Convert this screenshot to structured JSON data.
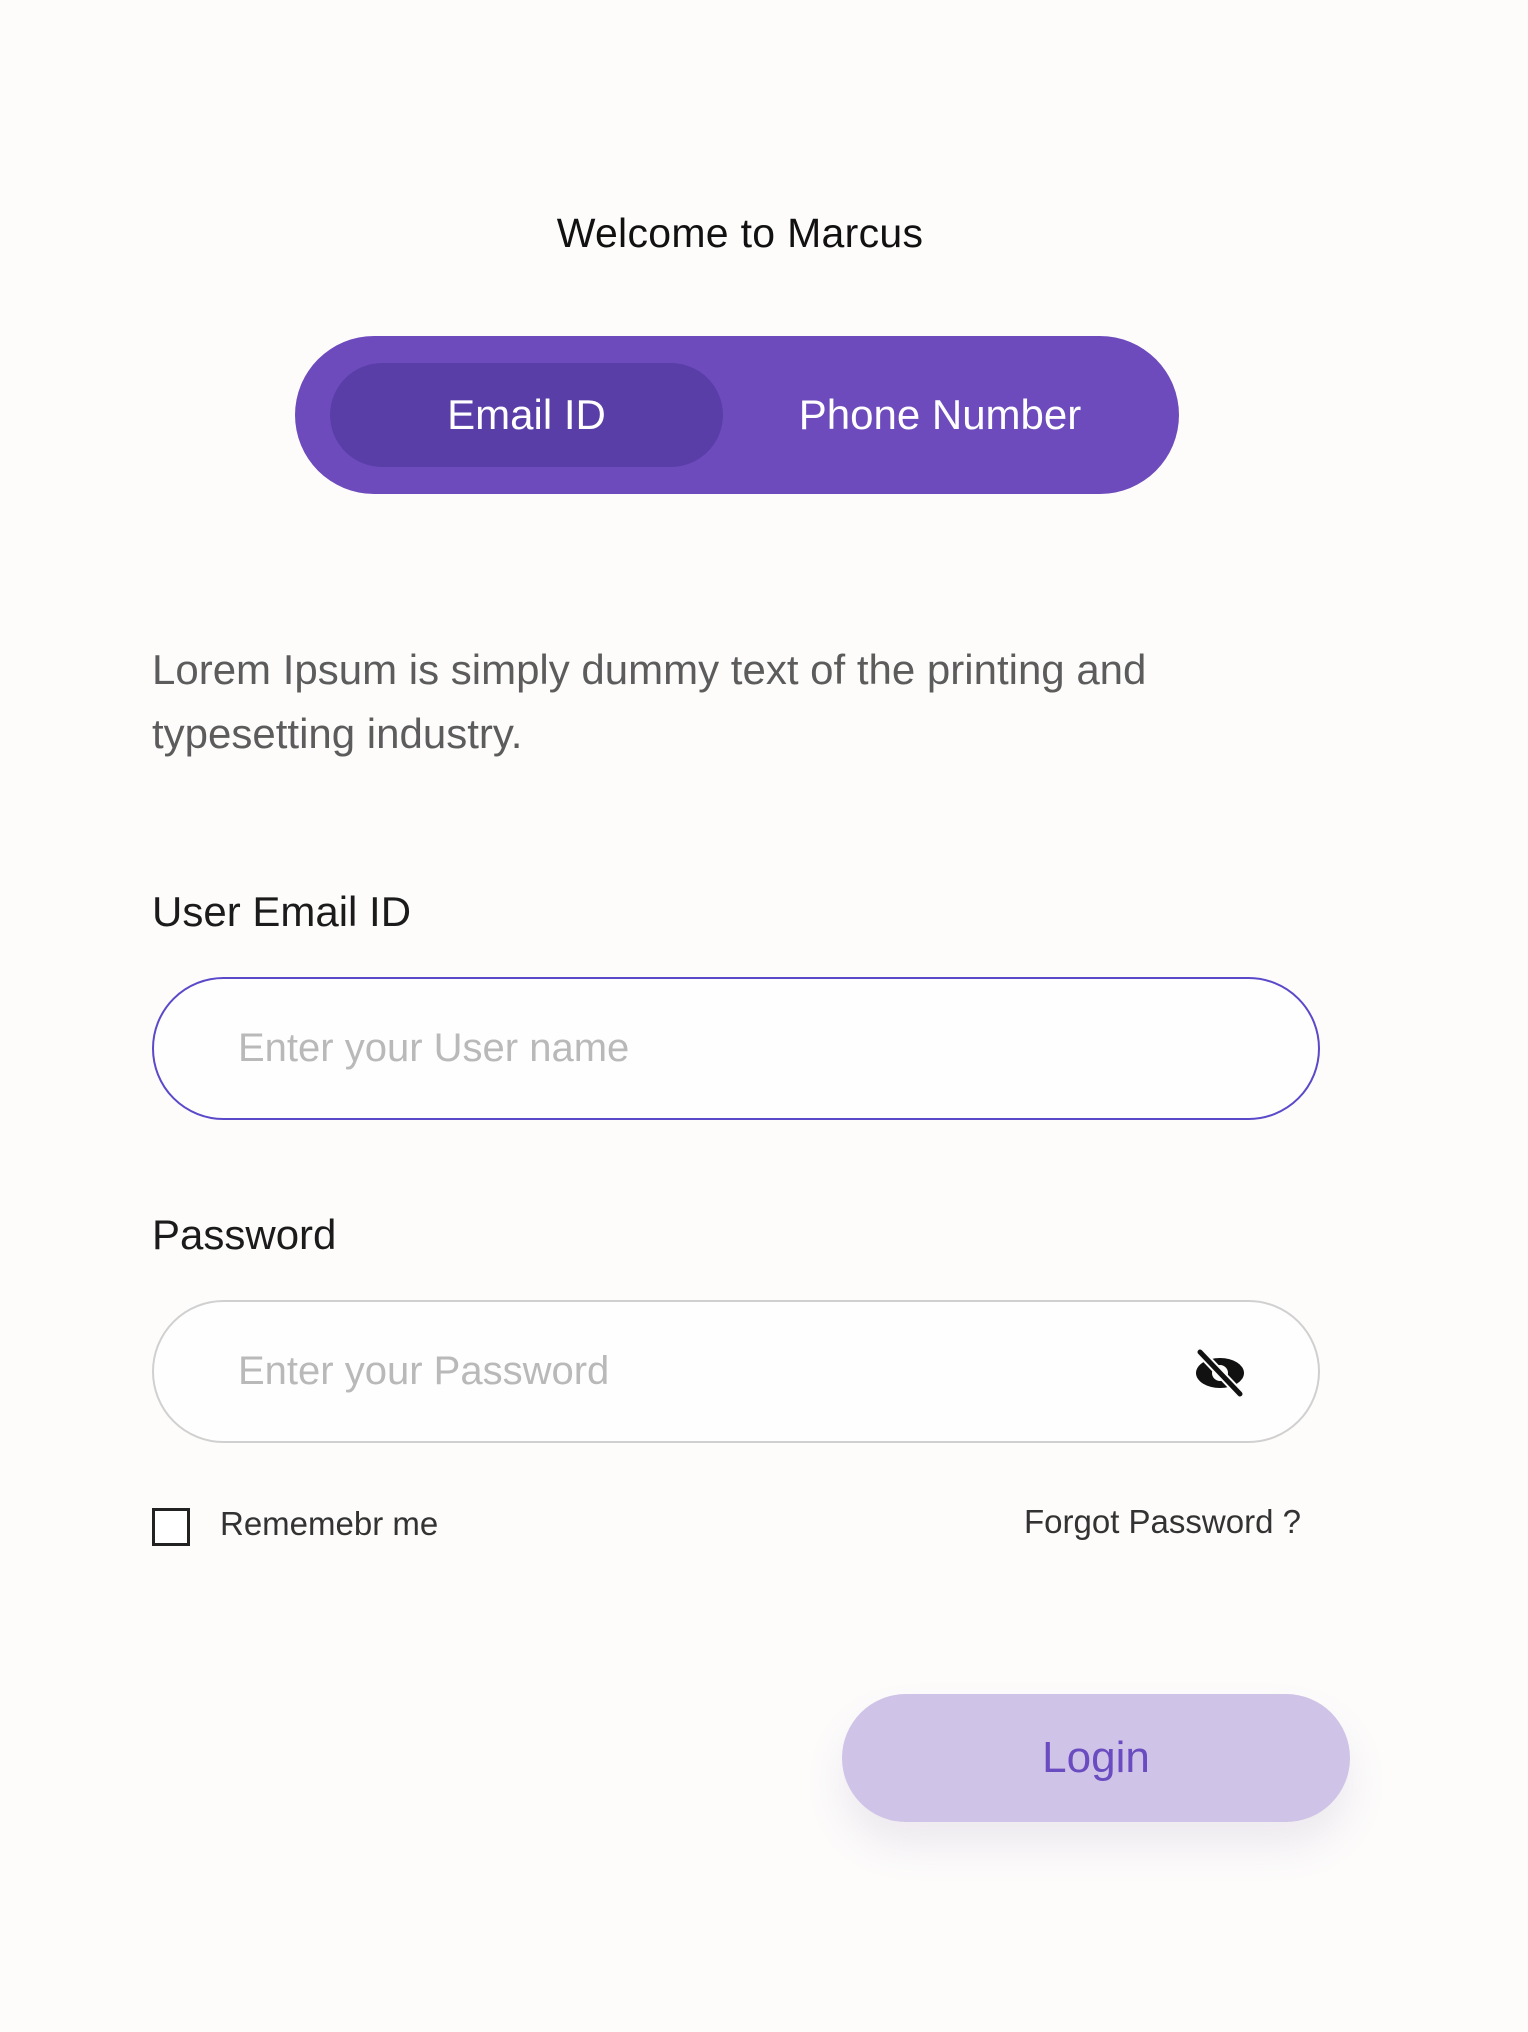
{
  "header": {
    "title": "Welcome to Marcus"
  },
  "toggle": {
    "options": [
      {
        "label": "Email ID",
        "active": true
      },
      {
        "label": "Phone Number",
        "active": false
      }
    ],
    "colors": {
      "background": "#6e4bbd",
      "active": "#5a3ea8"
    }
  },
  "description": "Lorem Ipsum is simply dummy text of the printing and typesetting industry.",
  "email_field": {
    "label": "User Email ID",
    "placeholder": "Enter your User name",
    "value": ""
  },
  "password_field": {
    "label": "Password",
    "placeholder": "Enter your Password",
    "value": "",
    "toggle_icon": "eye-slash-icon"
  },
  "remember": {
    "label": "Rememebr me",
    "checked": false
  },
  "forgot": {
    "label": "Forgot Password ?"
  },
  "login": {
    "label": "Login",
    "colors": {
      "background": "#cfc3e7",
      "text": "#6a4cc0"
    }
  }
}
